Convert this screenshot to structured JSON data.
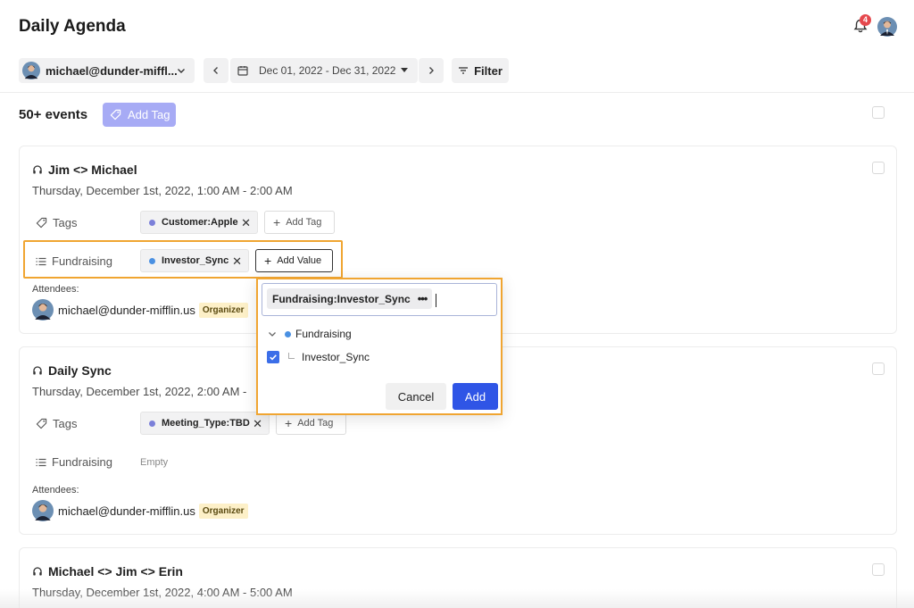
{
  "header": {
    "title": "Daily Agenda",
    "notification_count": "4"
  },
  "toolbar": {
    "user": "michael@dunder-miffl...",
    "date_range": "Dec 01, 2022 - Dec 31, 2022",
    "filter_label": "Filter"
  },
  "summary": {
    "count": "50+ events",
    "add_tag_label": "Add Tag"
  },
  "colors": {
    "accent": "#2f55e6",
    "highlight": "#f0a531",
    "tag_dot": "#7b80d9",
    "value_dot": "#4a90e2"
  },
  "labels": {
    "tags": "Tags",
    "fundraising": "Fundraising",
    "attendees": "Attendees:",
    "add_tag": "Add Tag",
    "add_value": "Add Value",
    "empty": "Empty",
    "organizer": "Organizer"
  },
  "events": [
    {
      "title": "Jim <> Michael",
      "time": "Thursday, December 1st, 2022, 1:00 AM - 2:00 AM",
      "tag": "Customer:Apple",
      "fundraising_value": "Investor_Sync",
      "attendee": "michael@dunder-mifflin.us"
    },
    {
      "title": "Daily Sync",
      "time": "Thursday, December 1st, 2022, 2:00 AM -",
      "tag": "Meeting_Type:TBD",
      "attendee": "michael@dunder-mifflin.us"
    },
    {
      "title": "Michael <> Jim <> Erin",
      "time": "Thursday, December 1st, 2022, 4:00 AM - 5:00 AM"
    }
  ],
  "popup": {
    "chip": "Fundraising:Investor_Sync",
    "chip_more": "•••",
    "tree_parent": "Fundraising",
    "tree_child": "Investor_Sync",
    "cancel_label": "Cancel",
    "add_label": "Add"
  }
}
